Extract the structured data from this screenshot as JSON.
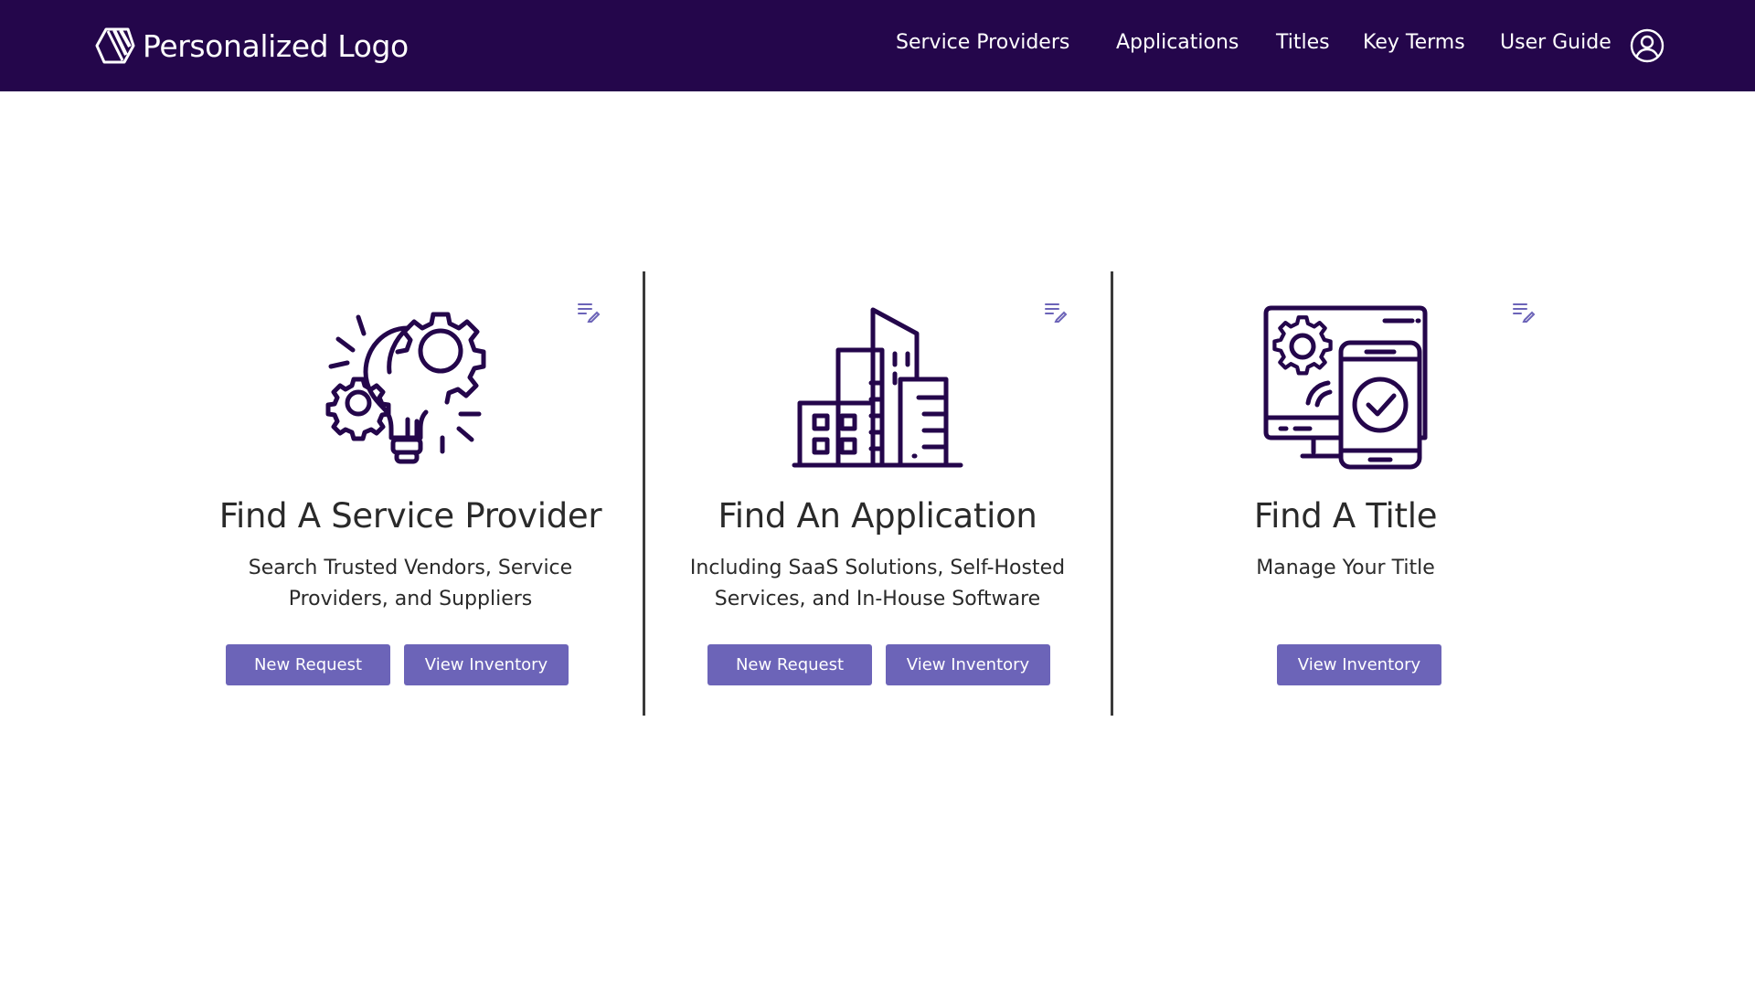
{
  "header": {
    "brand_text": "Personalized Logo",
    "nav": {
      "service_providers": "Service Providers",
      "applications": "Applications",
      "titles": "Titles",
      "key_terms": "Key Terms",
      "user_guide": "User Guide"
    },
    "user_icon": "user-circle-icon"
  },
  "cards": [
    {
      "icon": "gear-lightbulb-icon",
      "title": "Find A Service Provider",
      "subtitle": "Search Trusted Vendors, Service Providers, and Suppliers",
      "new_request_label": "New Request",
      "view_inventory_label": "View Inventory"
    },
    {
      "icon": "buildings-icon",
      "title": "Find An Application",
      "subtitle": "Including SaaS Solutions, Self-Hosted Services, and In-House Software",
      "new_request_label": "New Request",
      "view_inventory_label": "View Inventory"
    },
    {
      "icon": "devices-check-icon",
      "title": "Find A Title",
      "subtitle": "Manage Your Title",
      "view_inventory_label": "View Inventory"
    }
  ],
  "colors": {
    "header_bg": "#24064b",
    "button_bg": "#6c64b8",
    "icon_stroke": "#24064b",
    "text": "#2a2a2a"
  }
}
